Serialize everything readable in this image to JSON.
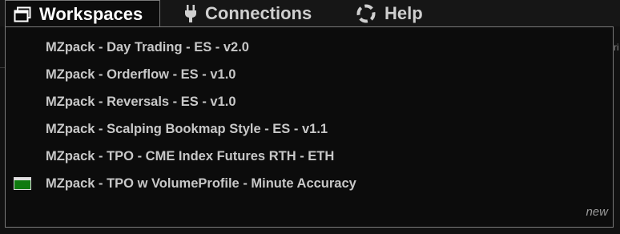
{
  "menubar": {
    "items": [
      {
        "label": "Workspaces",
        "icon": "window-icon",
        "active": true
      },
      {
        "label": "Connections",
        "icon": "plug-icon",
        "active": false
      },
      {
        "label": "Help",
        "icon": "lifebuoy-icon",
        "active": false
      }
    ]
  },
  "workspaces": {
    "items": [
      {
        "label": "MZpack - Day Trading - ES - v2.0",
        "active": false
      },
      {
        "label": "MZpack - Orderflow - ES - v1.0",
        "active": false
      },
      {
        "label": "MZpack - Reversals - ES - v1.0",
        "active": false
      },
      {
        "label": "MZpack - Scalping Bookmap Style - ES - v1.1",
        "active": false
      },
      {
        "label": "MZpack - TPO - CME Index Futures RTH - ETH",
        "active": false
      },
      {
        "label": "MZpack - TPO w VolumeProfile - Minute Accuracy",
        "active": true
      }
    ],
    "new_label": "new"
  },
  "colors": {
    "background": "#111111",
    "text": "#c8c8c8",
    "active_indicator": "#0f7a0f",
    "border": "#7a7a7a"
  }
}
